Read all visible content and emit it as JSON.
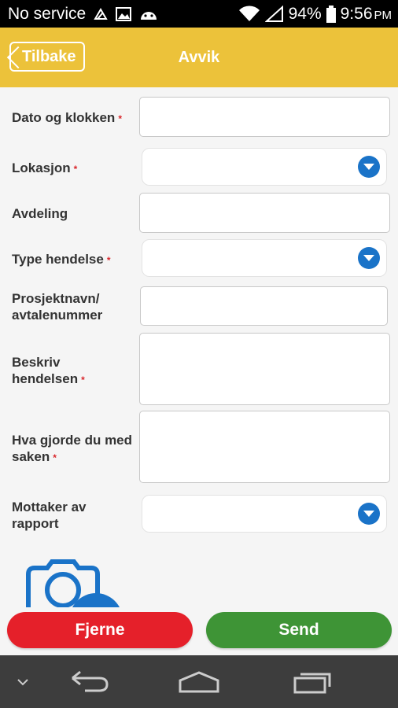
{
  "status_bar": {
    "carrier": "No service",
    "battery": "94%",
    "time": "9:56",
    "ampm": "PM",
    "icons": [
      "recycle-icon",
      "image-icon",
      "android-icon",
      "wifi-icon",
      "signal-icon",
      "battery-icon"
    ]
  },
  "header": {
    "back_label": "Tilbake",
    "title": "Avvik"
  },
  "form": {
    "date_time": {
      "label": "Dato og klokken",
      "required": "*",
      "value": ""
    },
    "location": {
      "label": "Lokasjon",
      "required": "*",
      "value": ""
    },
    "department": {
      "label": "Avdeling",
      "value": ""
    },
    "event_type": {
      "label": "Type hendelse",
      "required": "*",
      "value": ""
    },
    "project": {
      "label_line1": "Prosjektnavn/",
      "label_line2": "avtalenummer",
      "value": ""
    },
    "describe": {
      "label_line1": "Beskriv",
      "label_line2": "hendelsen",
      "required": "*",
      "value": ""
    },
    "action": {
      "label_line1": "Hva gjorde du med",
      "label_line2": "saken",
      "required": "*",
      "value": ""
    },
    "recipient": {
      "label_line1": "Mottaker av",
      "label_line2": "rapport",
      "value": ""
    }
  },
  "actions": {
    "remove_label": "Fjerne",
    "send_label": "Send"
  },
  "colors": {
    "header": "#ecc23a",
    "dropdown_icon": "#1a73c8",
    "required": "#d9262b",
    "remove": "#e5202a",
    "send": "#3e9436"
  }
}
